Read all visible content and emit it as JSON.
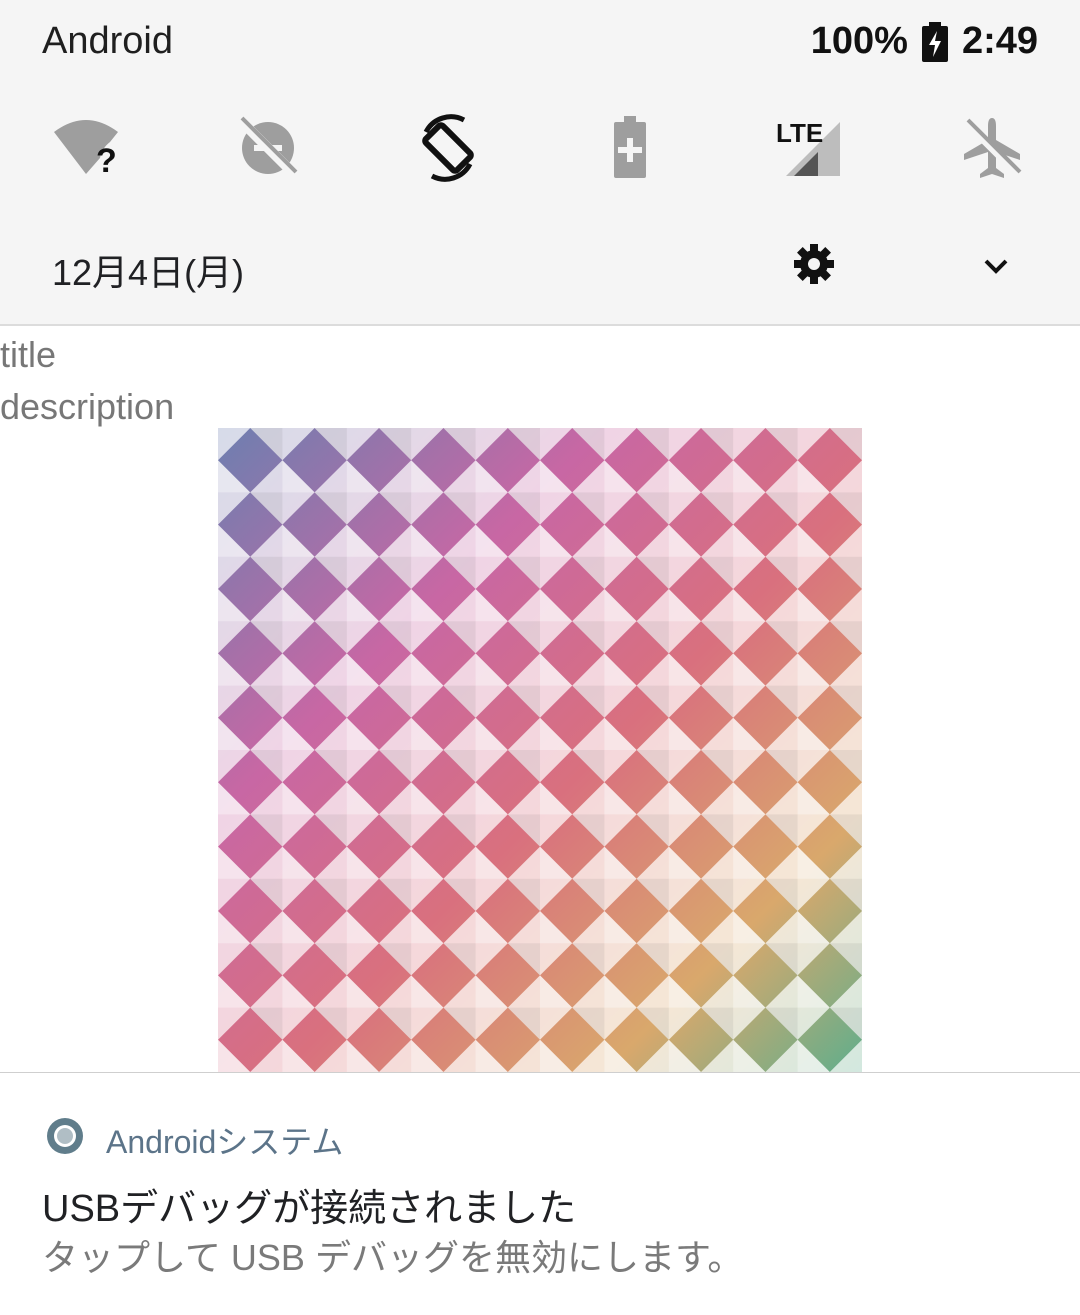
{
  "status_bar": {
    "carrier": "Android",
    "battery_percent": "100%",
    "time": "2:49"
  },
  "quick_settings": {
    "tiles": [
      {
        "icon": "wifi-unknown-icon"
      },
      {
        "icon": "do-not-disturb-off-icon"
      },
      {
        "icon": "auto-rotate-icon"
      },
      {
        "icon": "battery-saver-icon"
      },
      {
        "icon": "lte-signal-icon",
        "label": "LTE"
      },
      {
        "icon": "airplane-mode-icon"
      }
    ]
  },
  "shade_footer": {
    "date": "12月4日(月)"
  },
  "custom_notification": {
    "title": "title",
    "description": "description"
  },
  "system_notification": {
    "app_name": "Androidシステム",
    "title": "USBデバッグが接続されました",
    "text": "タップして USB デバッグを無効にします。"
  },
  "colors": {
    "shade_bg": "#f5f5f5",
    "app_name": "#5c7489",
    "secondary_text": "#7a7a7a"
  }
}
